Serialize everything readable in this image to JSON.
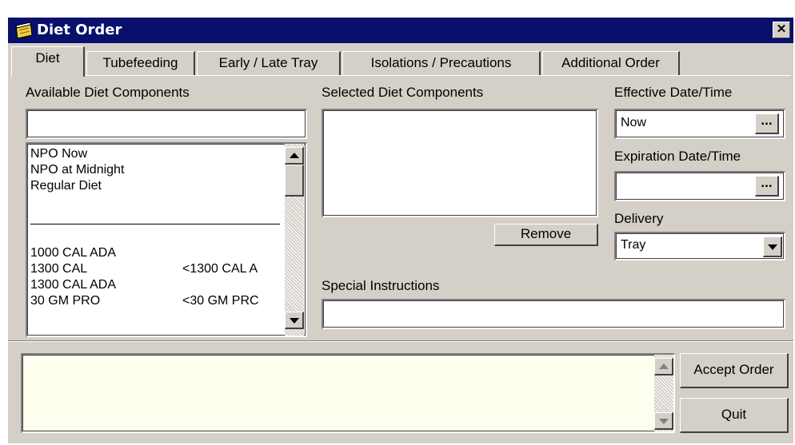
{
  "window": {
    "title": "Diet Order",
    "close_label": "✕"
  },
  "tabs": [
    {
      "label": "Diet"
    },
    {
      "label": "Tubefeeding"
    },
    {
      "label": "Early / Late Tray"
    },
    {
      "label": "Isolations / Precautions"
    },
    {
      "label": "Additional Order"
    }
  ],
  "available": {
    "label": "Available Diet Components",
    "search_value": "",
    "items_top": [
      "NPO Now",
      "NPO at Midnight",
      "Regular Diet"
    ],
    "items": [
      {
        "name": "1000 CAL ADA",
        "note": ""
      },
      {
        "name": "1300 CAL",
        "note": "<1300 CAL A"
      },
      {
        "name": "1300 CAL ADA",
        "note": ""
      },
      {
        "name": "30 GM PRO",
        "note": "<30 GM PRC"
      }
    ]
  },
  "selected": {
    "label": "Selected Diet Components",
    "remove_label": "Remove"
  },
  "effective": {
    "label": "Effective Date/Time",
    "value": "Now",
    "browse_label": "..."
  },
  "expiration": {
    "label": "Expiration Date/Time",
    "value": "",
    "browse_label": "..."
  },
  "delivery": {
    "label": "Delivery",
    "value": "Tray"
  },
  "special": {
    "label": "Special Instructions",
    "value": ""
  },
  "footer": {
    "accept_label": "Accept Order",
    "quit_label": "Quit"
  },
  "colors": {
    "titlebar": "#08106b",
    "face": "#d4d0c8",
    "order_text_bg": "#fffff0"
  }
}
